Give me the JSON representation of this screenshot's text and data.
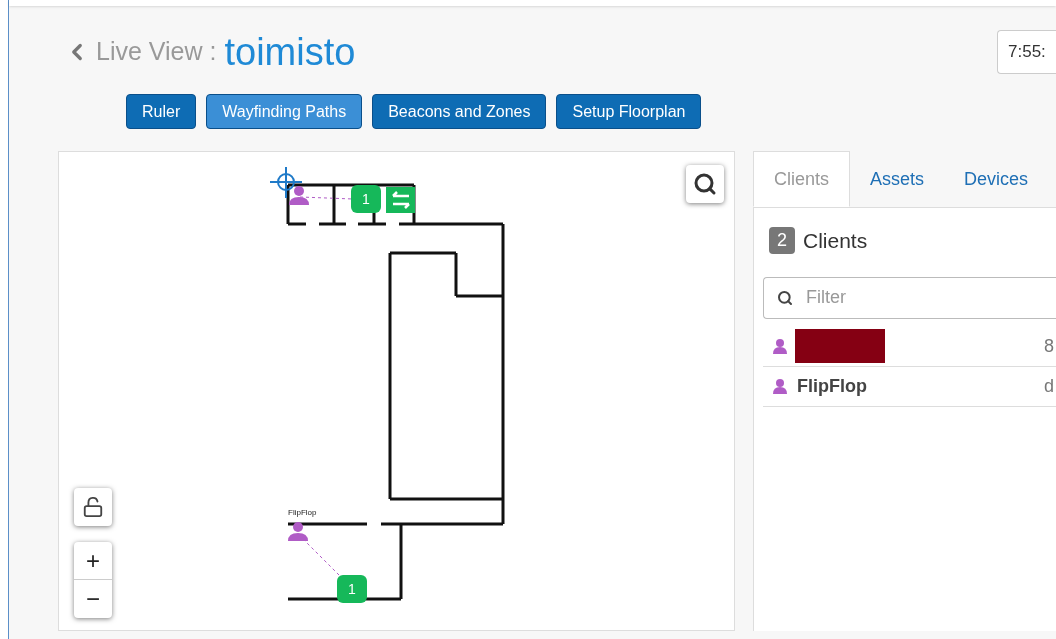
{
  "header": {
    "back_label": "Live View :",
    "title": "toimisto",
    "time": "7:55:"
  },
  "toolbar": [
    {
      "label": "Ruler",
      "selected": false
    },
    {
      "label": "Wayfinding Paths",
      "selected": true
    },
    {
      "label": "Beacons and Zones",
      "selected": false
    },
    {
      "label": "Setup Floorplan",
      "selected": false
    }
  ],
  "map": {
    "badges": [
      "1",
      "1"
    ],
    "person_labels": [
      "FlipFlop"
    ],
    "zoom_in": "+",
    "zoom_out": "−"
  },
  "tabs": [
    {
      "label": "Clients",
      "selected": true
    },
    {
      "label": "Assets",
      "selected": false
    },
    {
      "label": "Devices",
      "selected": false
    }
  ],
  "clients": {
    "count": "2",
    "heading": "Clients",
    "filter_placeholder": "Filter",
    "rows": [
      {
        "kind": "redacted",
        "value": "8"
      },
      {
        "kind": "named",
        "name": "FlipFlop",
        "value": "d"
      }
    ]
  }
}
